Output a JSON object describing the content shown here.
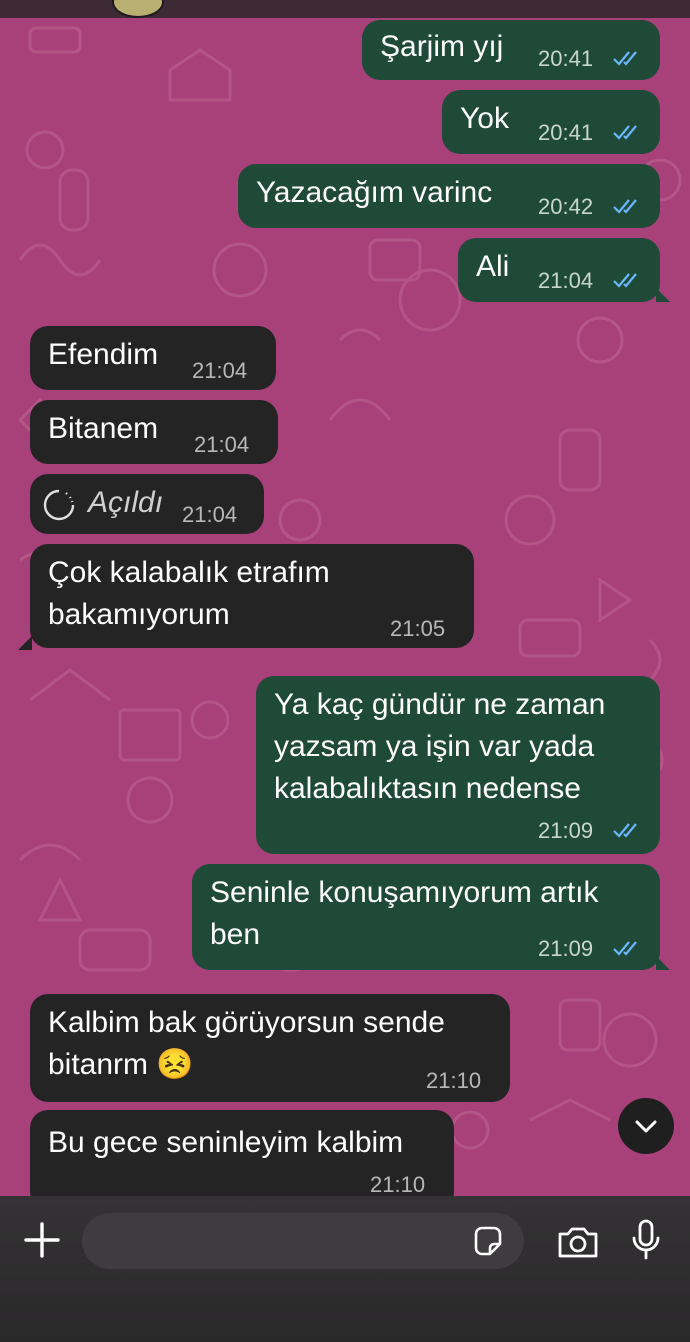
{
  "messages": [
    {
      "dir": "out",
      "text": "Şarjim yıj",
      "time": "20:41"
    },
    {
      "dir": "out",
      "text": "Yok",
      "time": "20:41"
    },
    {
      "dir": "out",
      "text": "Yazacağım varinc",
      "time": "20:42"
    },
    {
      "dir": "out",
      "text": "Ali",
      "time": "21:04"
    },
    {
      "dir": "in",
      "text": "Efendim",
      "time": "21:04"
    },
    {
      "dir": "in",
      "text": "Bitanem",
      "time": "21:04"
    },
    {
      "dir": "in",
      "text": "Açıldı",
      "time": "21:04",
      "view_once": true
    },
    {
      "dir": "in",
      "lines": [
        "Çok kalabalık etrafım",
        "bakamıyorum"
      ],
      "time": "21:05"
    },
    {
      "dir": "out",
      "lines": [
        "Ya kaç gündür ne zaman",
        "yazsam ya işin var yada",
        "kalabalıktasın nedense"
      ],
      "time": "21:09"
    },
    {
      "dir": "out",
      "lines": [
        "Seninle konuşamıyorum artık",
        "ben"
      ],
      "time": "21:09"
    },
    {
      "dir": "in",
      "lines": [
        "Kalbim bak görüyorsun sende",
        "bitanrm 😣"
      ],
      "time": "21:10"
    },
    {
      "dir": "in",
      "text": "Bu gece seninleyim kalbim",
      "time": "21:10"
    }
  ],
  "icons": {
    "read_receipt": "double-check-icon",
    "scroll_down": "chevron-down-icon",
    "add": "plus-icon",
    "sticker": "sticker-icon",
    "camera": "camera-icon",
    "mic": "microphone-icon"
  },
  "colors": {
    "wallpaper": "#a8407a",
    "outgoing_bubble": "#1f4a37",
    "incoming_bubble": "#242424",
    "read_check": "#6ab7ff"
  }
}
